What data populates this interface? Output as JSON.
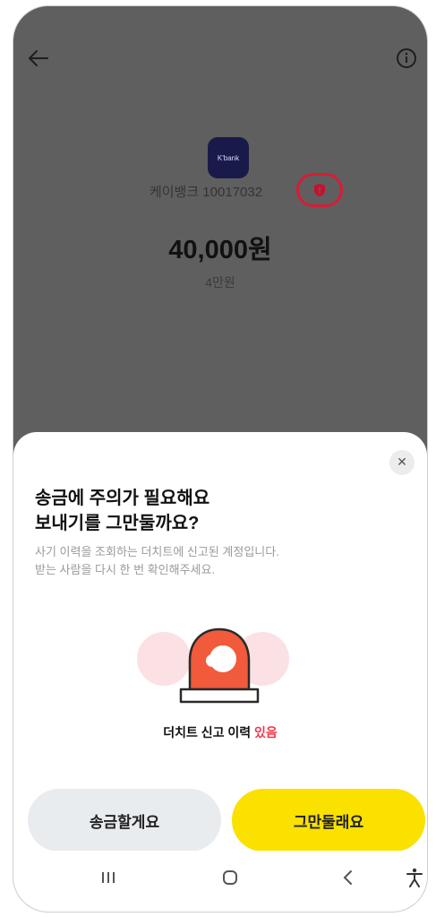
{
  "header": {
    "back_icon": "arrow-left-icon",
    "info_icon": "info-circle-icon"
  },
  "recipient": {
    "bank_logo_text": "K'bank",
    "account_label": "케이뱅크 10017032",
    "warning_icon": "red-shield-icon"
  },
  "amount": {
    "value": "40,000원",
    "korean": "4만원"
  },
  "sheet": {
    "close_icon": "close-icon",
    "title_line1": "송금에 주의가 필요해요",
    "title_line2": "보내기를 그만둘까요?",
    "desc_line1": "사기 이력을 조회하는 더치트에 신고된 계정입니다.",
    "desc_line2": "받는 사람을 다시 한 번 확인해주세요.",
    "illustration_icon": "siren-icon",
    "caption_prefix": "더치트 신고 이력 ",
    "caption_highlight": "있음",
    "send_button": "송금할게요",
    "stop_button": "그만둘래요"
  },
  "navbar": {
    "recents_icon": "recents-icon",
    "home_icon": "home-icon",
    "back_icon": "nav-back-icon",
    "accessibility_icon": "accessibility-icon"
  },
  "colors": {
    "overlay_bg": "#5f5f5f",
    "accent_yellow": "#fae100",
    "warning_red": "#d81c36",
    "highlight_red": "#f0384a"
  }
}
